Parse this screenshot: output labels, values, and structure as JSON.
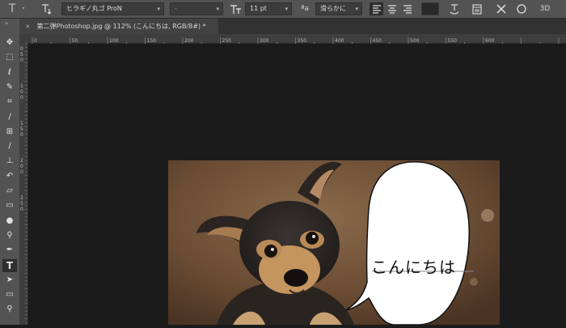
{
  "options_bar": {
    "font_family": "ヒラギノ丸ゴ ProN",
    "font_style": "-",
    "font_size": "11 pt",
    "antialias": "滑らかに",
    "color_swatch": "#2a2a2a",
    "icons": [
      "type-tool-icon",
      "orientation-toggle-icon",
      "font-size-icon",
      "antialias-icon",
      "align-left-icon",
      "align-center-icon",
      "align-right-icon",
      "warp-text-icon",
      "character-panel-icon",
      "cancel-icon",
      "commit-icon",
      "3d-icon"
    ],
    "three_d_label": "3D"
  },
  "document_tab": {
    "title": "第二弾Photoshop.jpg @ 112% (こんにちは, RGB/8#) *",
    "close_glyph": "×"
  },
  "tools": [
    "move-tool-icon",
    "marquee-tool-icon",
    "lasso-tool-icon",
    "quick-select-tool-icon",
    "crop-tool-icon",
    "eyedropper-tool-icon",
    "healing-brush-tool-icon",
    "brush-tool-icon",
    "clone-stamp-tool-icon",
    "history-brush-tool-icon",
    "eraser-tool-icon",
    "gradient-tool-icon",
    "blur-tool-icon",
    "dodge-tool-icon",
    "pen-tool-icon",
    "type-tool-icon",
    "path-select-tool-icon",
    "rectangle-tool-icon",
    "zoom-tool-icon"
  ],
  "rulers": {
    "horizontal_labels": [
      "0",
      "50",
      "100",
      "150",
      "200",
      "250",
      "300",
      "350",
      "400",
      "450",
      "500",
      "550",
      "600"
    ],
    "vertical_labels": [
      "0",
      "5",
      "0",
      "1",
      "0",
      "0",
      "1",
      "5",
      "0",
      "2",
      "0",
      "0",
      "2",
      "5",
      "0"
    ]
  },
  "speech_bubble": {
    "text": "こんにちは"
  }
}
